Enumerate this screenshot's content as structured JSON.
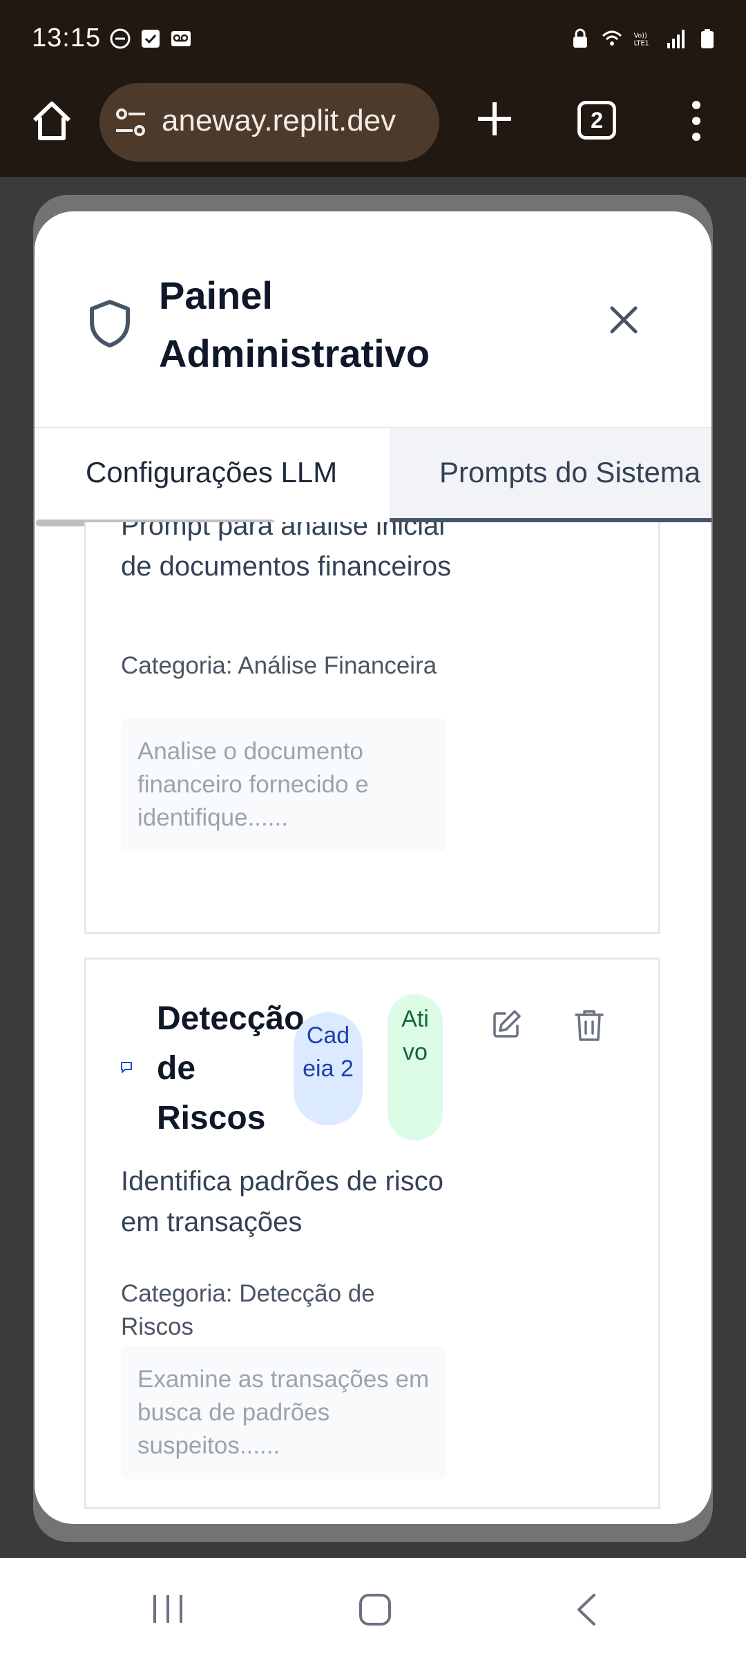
{
  "status_bar": {
    "time": "13:15",
    "icons_left": [
      "do-not-disturb-icon",
      "checkbox-icon",
      "voicemail-icon"
    ],
    "icons_right": [
      "lock-icon",
      "wifi-icon",
      "volte-lte-icon",
      "signal-icon",
      "battery-icon"
    ]
  },
  "browser": {
    "url": "aneway.replit.dev",
    "tab_count": "2"
  },
  "modal": {
    "title": "Painel Administrativo",
    "tabs": [
      {
        "label": "Configurações LLM"
      },
      {
        "label": "Prompts do Sistema"
      }
    ]
  },
  "prompts": [
    {
      "description": "Prompt para análise inicial de documentos financeiros",
      "category": "Categoria: Análise Financeira",
      "preview": "Analise o documento financeiro fornecido e identifique......"
    },
    {
      "title": "Detecção de Riscos",
      "chain_badge": "Cadeia 2",
      "status_badge": "Ativo",
      "description": "Identifica padrões de risco em transações",
      "category": "Categoria: Detecção de Riscos",
      "preview": "Examine as transações em busca de padrões suspeitos......"
    }
  ],
  "colors": {
    "chain_badge_bg": "#dbeafe",
    "active_badge_bg": "#dcfce7",
    "browser_bar": "#221812"
  }
}
